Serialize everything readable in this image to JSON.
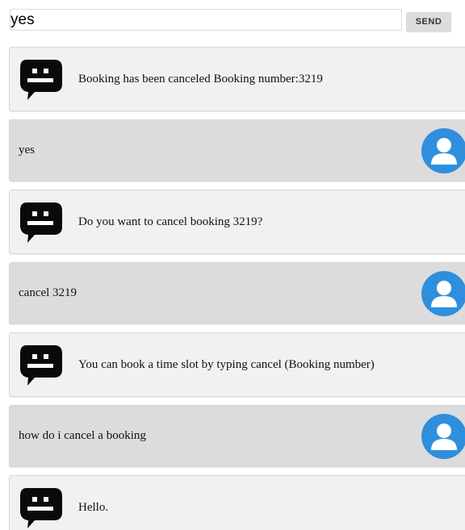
{
  "input": {
    "value": "yes",
    "send_label": "SEND"
  },
  "colors": {
    "bot_bubble": "#f1f1f1",
    "user_bubble": "#dcdcdc",
    "user_avatar": "#2f8fdc"
  },
  "icons": {
    "bot": "bot-speech-bubble-icon",
    "user": "user-avatar-icon"
  },
  "messages": [
    {
      "sender": "bot",
      "text": "Booking has been canceled Booking number:3219"
    },
    {
      "sender": "user",
      "text": "yes"
    },
    {
      "sender": "bot",
      "text": "Do you want to cancel booking 3219?"
    },
    {
      "sender": "user",
      "text": "cancel 3219"
    },
    {
      "sender": "bot",
      "text": "You can book a time slot by typing cancel (Booking number)"
    },
    {
      "sender": "user",
      "text": "how do i cancel a booking"
    },
    {
      "sender": "bot",
      "text": "Hello."
    }
  ]
}
